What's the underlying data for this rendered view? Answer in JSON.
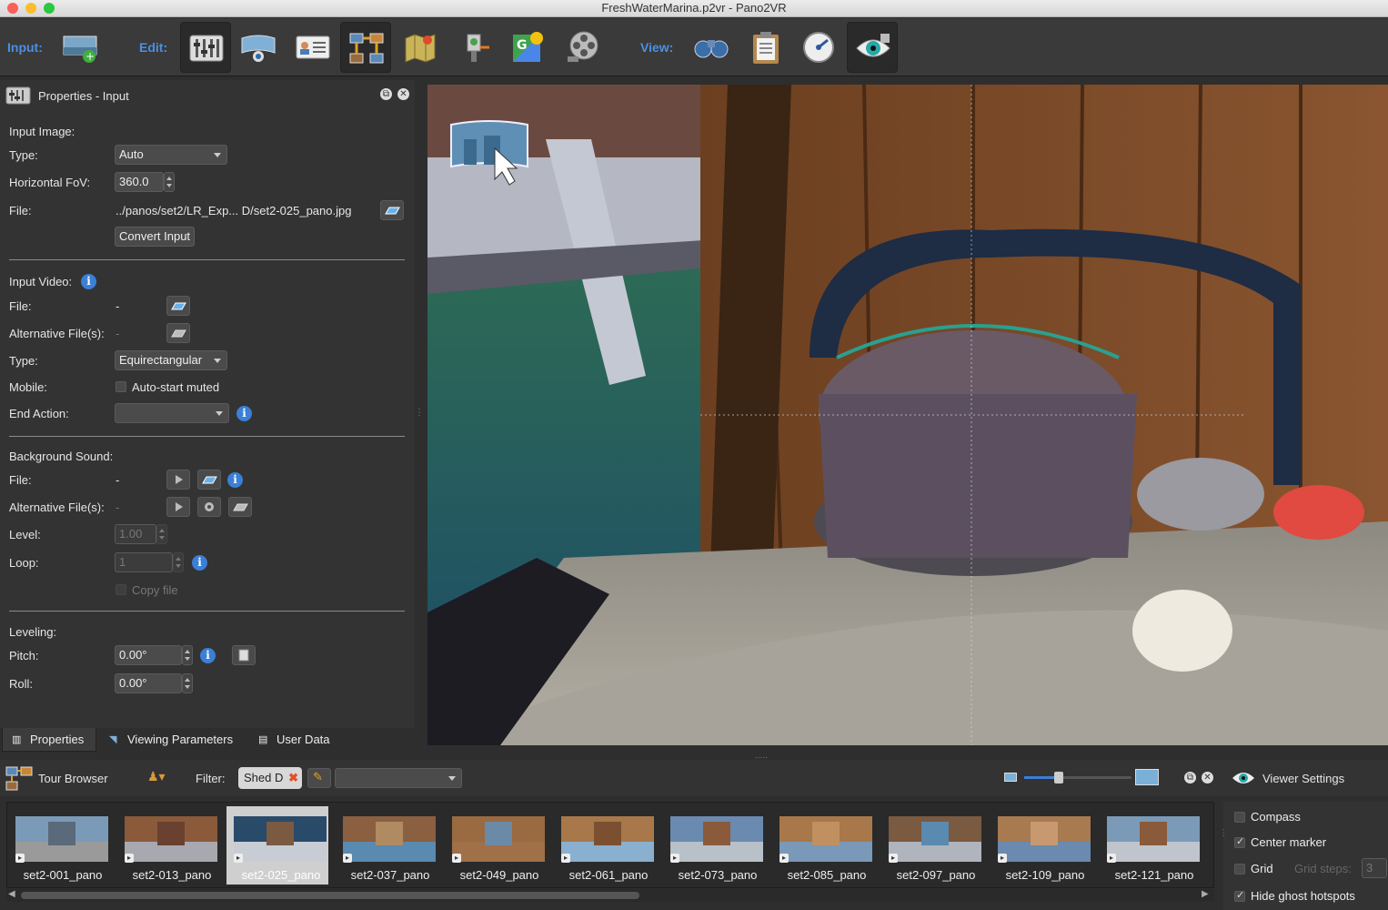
{
  "window": {
    "title": "FreshWaterMarina.p2vr - Pano2VR"
  },
  "toolbar": {
    "input_label": "Input:",
    "edit_label": "Edit:",
    "view_label": "View:"
  },
  "properties": {
    "header": "Properties - Input",
    "input_image": {
      "section": "Input Image:",
      "type_label": "Type:",
      "type_value": "Auto",
      "hfov_label": "Horizontal FoV:",
      "hfov_value": "360.0",
      "file_label": "File:",
      "file_value": "../panos/set2/LR_Exp... D/set2-025_pano.jpg",
      "convert_button": "Convert Input"
    },
    "input_video": {
      "section": "Input Video:",
      "file_label": "File:",
      "file_value": "-",
      "alt_label": "Alternative File(s):",
      "alt_value": "-",
      "type_label": "Type:",
      "type_value": "Equirectangular",
      "mobile_label": "Mobile:",
      "mobile_checkbox": "Auto-start muted",
      "end_action_label": "End Action:",
      "end_action_value": ""
    },
    "background_sound": {
      "section": "Background Sound:",
      "file_label": "File:",
      "file_value": "-",
      "alt_label": "Alternative File(s):",
      "alt_value": "-",
      "level_label": "Level:",
      "level_value": "1.00",
      "loop_label": "Loop:",
      "loop_value": "1",
      "copy_file": "Copy file"
    },
    "leveling": {
      "section": "Leveling:",
      "pitch_label": "Pitch:",
      "pitch_value": "0.00°",
      "roll_label": "Roll:",
      "roll_value": "0.00°"
    }
  },
  "bottom_tabs": [
    "Properties",
    "Viewing Parameters",
    "User Data"
  ],
  "tour_browser": {
    "title": "Tour Browser",
    "filter_label": "Filter:",
    "filter_tag": "Shed D",
    "filter_value": "",
    "viewer_settings": "Viewer Settings"
  },
  "thumbnails": [
    {
      "name": "set2-001_pano",
      "selected": false
    },
    {
      "name": "set2-013_pano",
      "selected": false
    },
    {
      "name": "set2-025_pano",
      "selected": true
    },
    {
      "name": "set2-037_pano",
      "selected": false
    },
    {
      "name": "set2-049_pano",
      "selected": false
    },
    {
      "name": "set2-061_pano",
      "selected": false
    },
    {
      "name": "set2-073_pano",
      "selected": false
    },
    {
      "name": "set2-085_pano",
      "selected": false
    },
    {
      "name": "set2-097_pano",
      "selected": false
    },
    {
      "name": "set2-109_pano",
      "selected": false
    },
    {
      "name": "set2-121_pano",
      "selected": false
    }
  ],
  "viewer_settings": {
    "compass": {
      "label": "Compass",
      "checked": false
    },
    "center_marker": {
      "label": "Center marker",
      "checked": true
    },
    "grid": {
      "label": "Grid",
      "checked": false
    },
    "grid_steps_label": "Grid steps:",
    "grid_steps_value": "3",
    "hide_ghost": {
      "label": "Hide ghost hotspots",
      "checked": true
    }
  },
  "colors": {
    "accent": "#4a90e2",
    "panel": "#333333",
    "info": "#3b7fd6"
  }
}
